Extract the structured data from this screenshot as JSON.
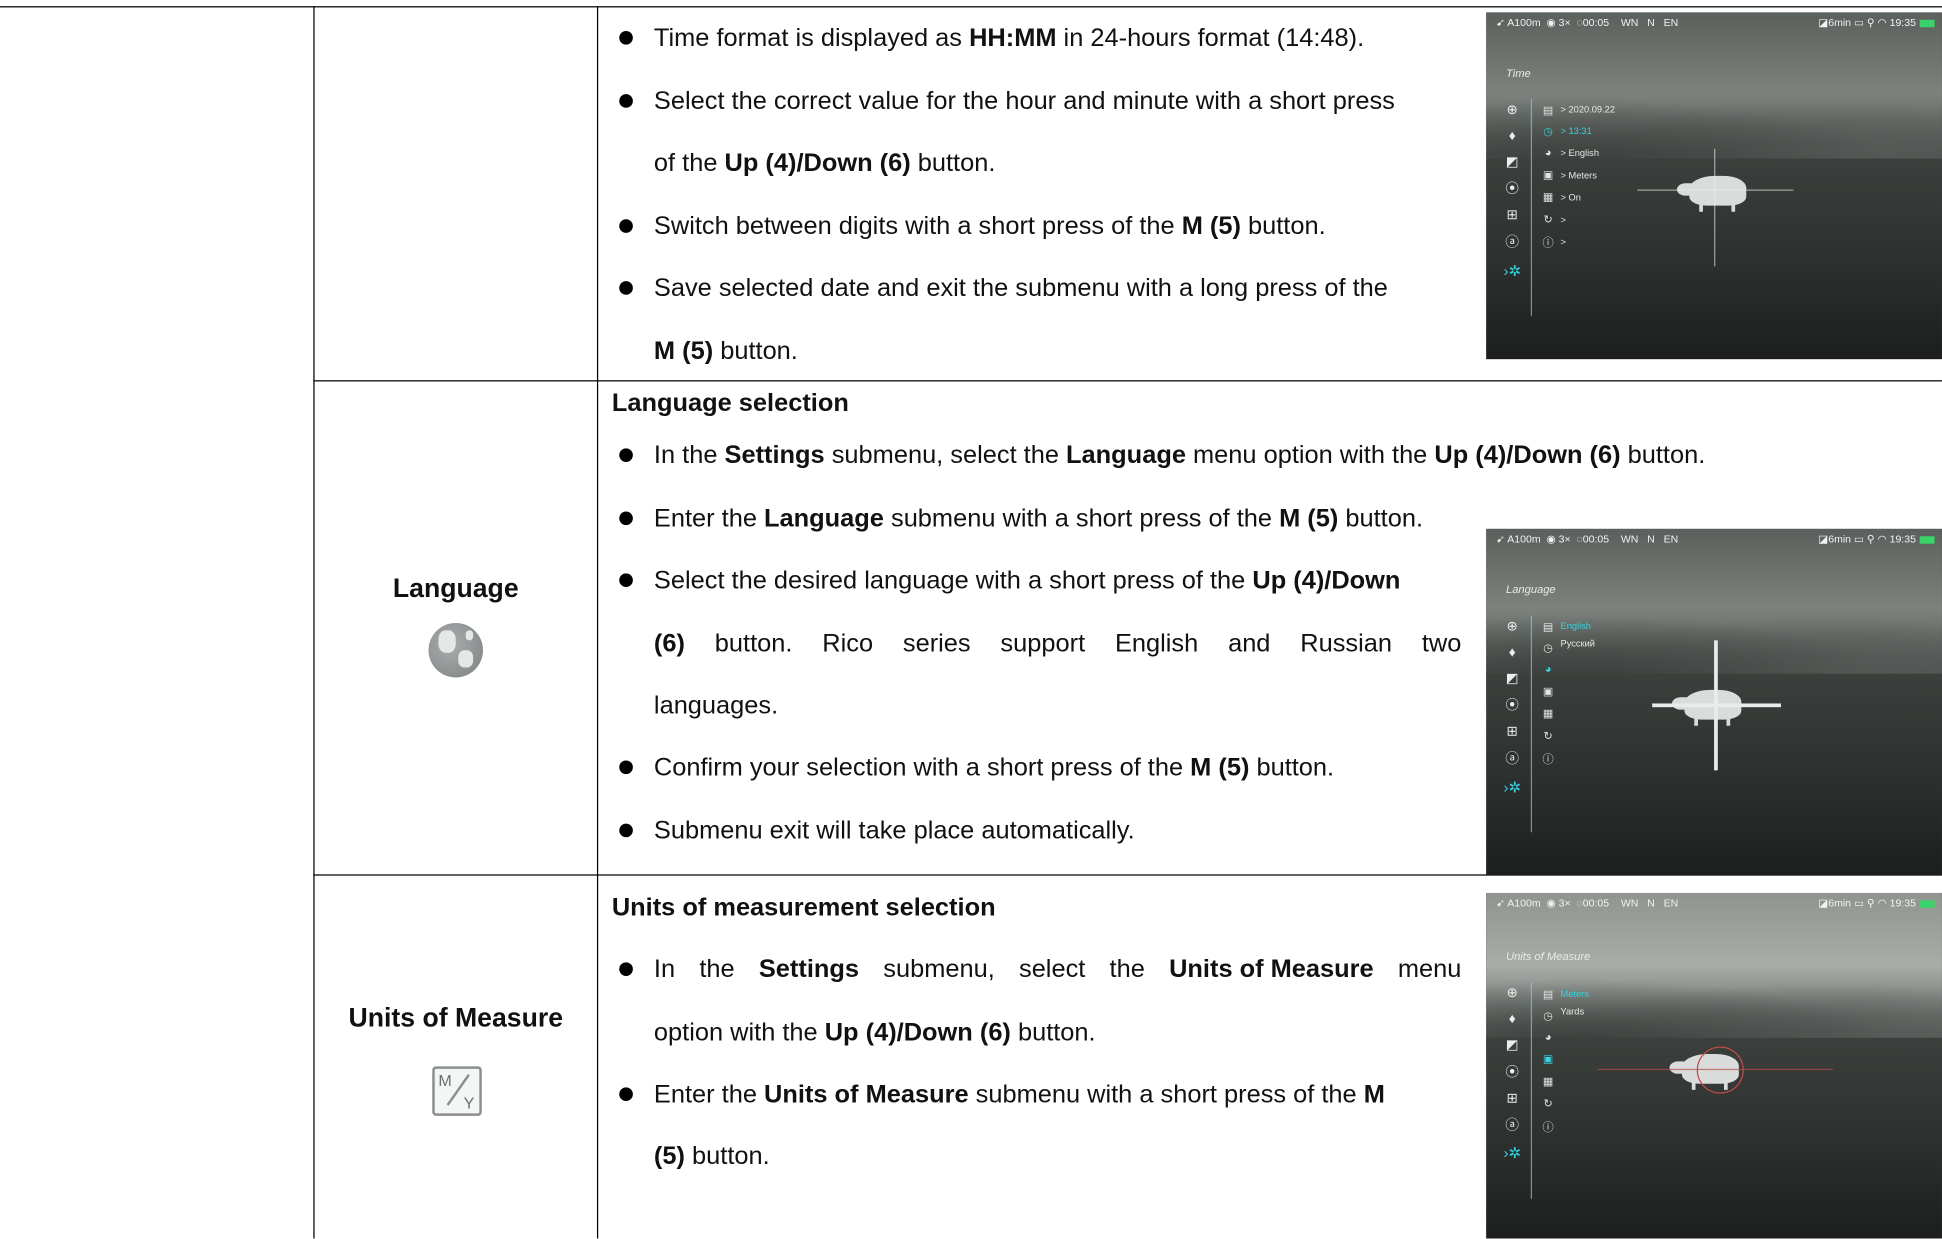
{
  "rows": [
    {
      "label": "",
      "heading": "",
      "bullets": [
        "Time format is displayed as <b>HH:MM</b> in 24-hours format (14:48).",
        "Select the correct value for the hour and minute with a short press",
        "of the <b>Up (4)/Down (6)</b> button.",
        "Switch between digits with a short press of the <b>M (5)</b> button.",
        "Save selected date and exit the submenu with a long press of the",
        "<b>M (5)</b> button."
      ]
    },
    {
      "label": "Language",
      "icon": "globe-icon",
      "heading": "Language selection",
      "bullets": [
        "In the <b>Settings</b> submenu, select the <b>Language</b> menu option with the <b>Up (4)/Down (6)</b> button.",
        "Enter the <b>Language</b> submenu with a short press of the <b>M (5)</b> button.",
        "Select the desired language with a short press of the <b>Up (4)/Down</b>",
        "<b>(6)</b> button. Rico series support English and Russian two",
        "languages.",
        "Confirm your selection with a short press of the <b>M (5)</b> button.",
        "Submenu exit will take place automatically."
      ]
    },
    {
      "label": "Units of Measure",
      "icon": "units-icon",
      "heading": "Units of measurement selection",
      "bullets": [
        "In the <b>Settings</b> submenu, select the <b>Units of Measure</b> menu",
        "option with the <b>Up (4)/Down (6)</b> button.",
        "Enter the <b>Units of Measure</b> submenu with a short press of the <b>M</b>",
        "<b>(5)</b> button."
      ]
    }
  ],
  "row1": {
    "b1": [
      "Time format is displayed as ",
      "HH:MM",
      " in 24-hours format (14:48)."
    ],
    "b2a": "Select the correct value for the hour and minute with a short press",
    "b2b": [
      "of the ",
      "Up (4)/Down (6)",
      " button."
    ],
    "b3": [
      "Switch between digits with a short press of the ",
      "M (5)",
      " button."
    ],
    "b4a": "Save selected date and exit the submenu with a long press of the",
    "b4b": [
      "M (5)",
      " button."
    ]
  },
  "row2": {
    "label": "Language",
    "heading": "Language selection",
    "b1": [
      "In the ",
      "Settings",
      " submenu, select the ",
      "Language",
      " menu option with the ",
      "Up (4)/Down (6)",
      " button."
    ],
    "b2": [
      "Enter the ",
      "Language",
      " submenu with a short press of the ",
      "M (5)",
      " button."
    ],
    "b3a": [
      "Select the desired language with a short press of the ",
      "Up (4)/Down"
    ],
    "b3b": [
      "(6)",
      "button.",
      "Rico",
      "series",
      "support",
      "English",
      "and",
      "Russian",
      "two"
    ],
    "b3c": "languages.",
    "b4": [
      "Confirm your selection with a short press of the ",
      "M (5)",
      " button."
    ],
    "b5": "Submenu exit will take place automatically."
  },
  "row3": {
    "label": "Units of Measure",
    "heading": "Units of measurement selection",
    "b1a": [
      "In",
      "the",
      "Settings",
      "submenu,",
      "select",
      "the",
      "Units of Measure",
      "menu"
    ],
    "b1b": [
      "option with the ",
      "Up (4)/Down (6)",
      " button."
    ],
    "b2a": [
      "Enter the ",
      "Units of Measure",
      " submenu with a short press of the ",
      "M"
    ],
    "b2b": [
      "(5)",
      " button."
    ]
  },
  "screens": {
    "status": {
      "range": "A100m",
      "zoom": "3×",
      "timer": "00:05",
      "compass": [
        "WN",
        "N",
        "EN"
      ],
      "timeout": "6min",
      "clock": "19:35"
    },
    "time": {
      "title": "Time",
      "options": [
        "> 2020.09.22",
        "> 13:31",
        "> English",
        "> Meters",
        "> On",
        ">",
        ">"
      ]
    },
    "language": {
      "title": "Language",
      "options": [
        "English",
        "Русский"
      ]
    },
    "units": {
      "title": "Units of Measure",
      "options": [
        "Meters",
        "Yards"
      ]
    }
  }
}
